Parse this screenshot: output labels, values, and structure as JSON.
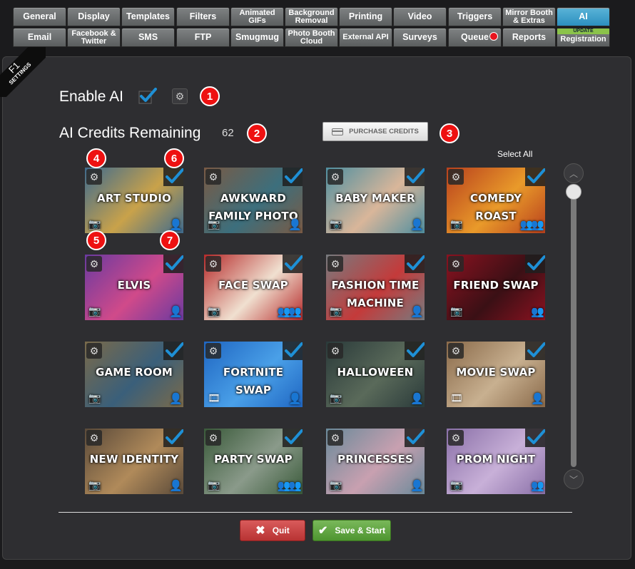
{
  "tabs_row1": [
    "General",
    "Display",
    "Templates",
    "Filters",
    "Animated GIFs",
    "Background Removal",
    "Printing",
    "Video",
    "Triggers",
    "Mirror Booth & Extras",
    "AI"
  ],
  "tabs_row2": [
    "Email",
    "Facebook & Twitter",
    "SMS",
    "FTP",
    "Smugmug",
    "Photo Booth Cloud",
    "External API",
    "Surveys",
    "Queue",
    "Reports",
    "Registration"
  ],
  "active_tab": "AI",
  "update_badge": "UPDATE",
  "settings_ribbon": {
    "key": "F1",
    "label": "SETTINGS"
  },
  "enable_ai": {
    "label": "Enable AI",
    "checked": true
  },
  "credits": {
    "label": "AI Credits Remaining",
    "value": "62"
  },
  "purchase_button": "PURCHASE CREDITS",
  "select_all": "Select All",
  "callouts": [
    "1",
    "2",
    "3",
    "4",
    "5",
    "6",
    "7"
  ],
  "tiles": [
    {
      "name": "ART STUDIO",
      "mode": "camera-icon",
      "people": "single-person-icon",
      "bg": "#3f6b8e",
      "bg2": "#c9a24a",
      "checked": true
    },
    {
      "name": "AWKWARD FAMILY PHOTO",
      "mode": "camera-icon",
      "people": "single-person-icon",
      "bg": "#7a5a44",
      "bg2": "#3c6f7d",
      "checked": true
    },
    {
      "name": "BABY MAKER",
      "mode": "camera-icon",
      "people": "single-person-icon",
      "bg": "#4f8fa0",
      "bg2": "#d9b69a",
      "checked": true
    },
    {
      "name": "COMEDY ROAST",
      "mode": "camera-icon",
      "people": "group-icon",
      "bg": "#b8401d",
      "bg2": "#e99a2a",
      "checked": true
    },
    {
      "name": "ELVIS",
      "mode": "camera-icon",
      "people": "single-person-icon",
      "bg": "#6a3aa0",
      "bg2": "#d04a8a",
      "checked": true
    },
    {
      "name": "FACE SWAP",
      "mode": "camera-icon",
      "people": "group-icon",
      "bg": "#b62a2a",
      "bg2": "#f0e0d0",
      "checked": true
    },
    {
      "name": "FASHION TIME MACHINE",
      "mode": "camera-icon",
      "people": "single-person-icon",
      "bg": "#777b7f",
      "bg2": "#c43a3a",
      "checked": true
    },
    {
      "name": "FRIEND SWAP",
      "mode": "camera-icon",
      "people": "couple-icon",
      "bg": "#8a1220",
      "bg2": "#3a1015",
      "checked": true
    },
    {
      "name": "GAME ROOM",
      "mode": "camera-icon",
      "people": "single-person-icon",
      "bg": "#7a6a4a",
      "bg2": "#3a5f7a",
      "checked": true
    },
    {
      "name": "FORTNITE SWAP",
      "mode": "video-icon",
      "people": "single-person-icon",
      "bg": "#1f66c2",
      "bg2": "#4aa0e8",
      "checked": true
    },
    {
      "name": "HALLOWEEN",
      "mode": "camera-icon",
      "people": "single-person-icon",
      "bg": "#2a3a3a",
      "bg2": "#5a6a5a",
      "checked": true
    },
    {
      "name": "MOVIE SWAP",
      "mode": "video-icon",
      "people": "single-person-icon",
      "bg": "#8a6a4a",
      "bg2": "#c8b090",
      "checked": true
    },
    {
      "name": "NEW IDENTITY",
      "mode": "camera-icon",
      "people": "single-person-icon",
      "bg": "#5a4a3a",
      "bg2": "#b08a5a",
      "checked": true
    },
    {
      "name": "PARTY SWAP",
      "mode": "camera-icon",
      "people": "group-icon",
      "bg": "#3a5a3a",
      "bg2": "#8a9a8a",
      "checked": true
    },
    {
      "name": "PRINCESSES",
      "mode": "camera-icon",
      "people": "single-person-icon",
      "bg": "#6a8a9a",
      "bg2": "#c8a0b0",
      "checked": true
    },
    {
      "name": "PROM NIGHT",
      "mode": "camera-icon",
      "people": "couple-icon",
      "bg": "#8a70a8",
      "bg2": "#c8b0d8",
      "checked": true
    }
  ],
  "quit_button": "Quit",
  "save_button": "Save & Start",
  "colors": {
    "accent": "#2c8fbf",
    "check": "#1e90d6",
    "callout": "#e11111",
    "quit": "#c03b3b",
    "save": "#5a9e3a"
  }
}
